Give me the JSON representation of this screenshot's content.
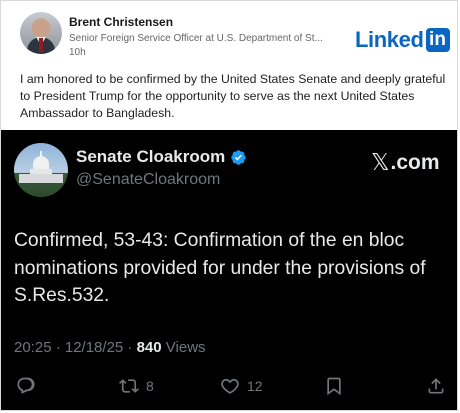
{
  "linkedin": {
    "author_name": "Brent Christensen",
    "headline": "Senior Foreign Service Officer at U.S. Department of St...",
    "time": "10h",
    "logo_word": "Linked",
    "logo_box": "in",
    "body": "I am honored to be confirmed by the United States Senate and deeply grateful to President Trump for the opportunity to serve as the next United States Ambassador to Bangladesh.",
    "brand_color": "#0a66c2"
  },
  "tweet": {
    "display_name": "Senate Cloakroom",
    "handle": "@SenateCloakroom",
    "source_logo": ".com",
    "source_logo_mark": "𝕏",
    "text": "Confirmed, 53-43: Confirmation of the en bloc nominations provided for under the provisions of S.Res.532.",
    "timestamp": "20:25 · 12/18/25 · ",
    "views_count": "840",
    "views_label": " Views",
    "reply_icon": "reply-icon",
    "retweet_count": "8",
    "like_count": "12",
    "verified_color": "#1d9bf0"
  }
}
